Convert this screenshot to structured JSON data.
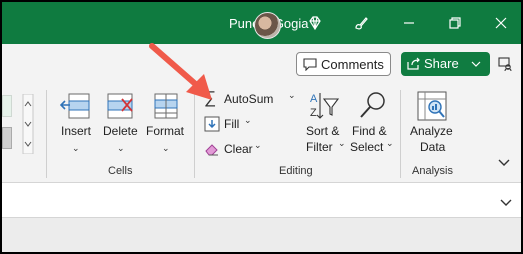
{
  "titlebar": {
    "user_name": "Puneet Gogia",
    "bg_color": "#0f7b40"
  },
  "header_buttons": {
    "comments_label": "Comments",
    "share_label": "Share"
  },
  "cells_group": {
    "label": "Cells",
    "insert_label": "Insert",
    "delete_label": "Delete",
    "format_label": "Format"
  },
  "editing_group": {
    "label": "Editing",
    "autosum_label": "AutoSum",
    "fill_label": "Fill",
    "clear_label": "Clear",
    "sort_label_1": "Sort &",
    "sort_label_2": "Filter",
    "find_label_1": "Find &",
    "find_label_2": "Select"
  },
  "analysis_group": {
    "label": "Analysis",
    "analyze_label_1": "Analyze",
    "analyze_label_2": "Data"
  },
  "annotation": {
    "arrow_color": "#f05a4a"
  },
  "icons": [
    "diamond-icon",
    "brush-icon",
    "restore-icon",
    "close-icon",
    "comment-icon",
    "share-icon",
    "pane-icon",
    "insert-icon",
    "delete-icon",
    "format-icon",
    "sigma-icon",
    "fill-icon",
    "eraser-icon",
    "sort-filter-icon",
    "search-icon",
    "analyze-data-icon",
    "collapse-ribbon-icon"
  ]
}
